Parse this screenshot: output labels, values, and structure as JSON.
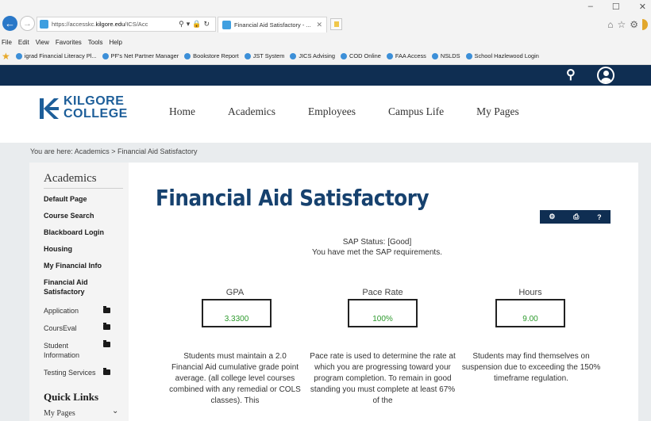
{
  "browser": {
    "url_prefix": "https://accesskc.",
    "url_host": "kilgore.edu",
    "url_suffix": "/ICS/Acc",
    "tab_title": "Financial Aid Satisfactory - ...",
    "menu": [
      "File",
      "Edit",
      "View",
      "Favorites",
      "Tools",
      "Help"
    ],
    "favorites": [
      "igrad Financial Literacy Pl...",
      "PF's Net Partner Manager",
      "Bookstore Report",
      "JST System",
      "JICS Advising",
      "COD Online",
      "FAA Access",
      "NSLDS",
      "School Hazlewood Login"
    ]
  },
  "site": {
    "logo_line1": "KILGORE",
    "logo_line2": "COLLEGE",
    "nav": [
      "Home",
      "Academics",
      "Employees",
      "Campus Life",
      "My Pages"
    ]
  },
  "breadcrumb": "You are here:  Academics > Financial Aid Satisfactory",
  "sidebar": {
    "title": "Academics",
    "links": [
      "Default Page",
      "Course Search",
      "Blackboard Login",
      "Housing",
      "My Financial Info",
      "Financial Aid Satisfactory"
    ],
    "subitems": [
      "Application",
      "CoursEval",
      "Student Information",
      "Testing Services"
    ],
    "quick_links_title": "Quick Links",
    "quick_links_select": "My Pages"
  },
  "main": {
    "title": "Financial Aid Satisfactory",
    "sap_status": "SAP Status: [Good]",
    "sap_message": "You have met the SAP requirements.",
    "stats": [
      {
        "label": "GPA",
        "value": "3.3300"
      },
      {
        "label": "Pace Rate",
        "value": "100%"
      },
      {
        "label": "Hours",
        "value": "9.00"
      }
    ],
    "paragraphs": [
      "Students must maintain a 2.0 Financial Aid cumulative grade point average. (all college level courses combined with any remedial or COLS classes). This",
      "Pace rate is used to determine the rate at which you are progressing toward your program completion. To remain in good standing you must complete at least 67% of the",
      "Students may find themselves on suspension due to exceeding the 150% timeframe regulation."
    ]
  },
  "colors": {
    "header_navy": "#0f2e52",
    "title_blue": "#16416e",
    "value_green": "#2d9a2d"
  }
}
